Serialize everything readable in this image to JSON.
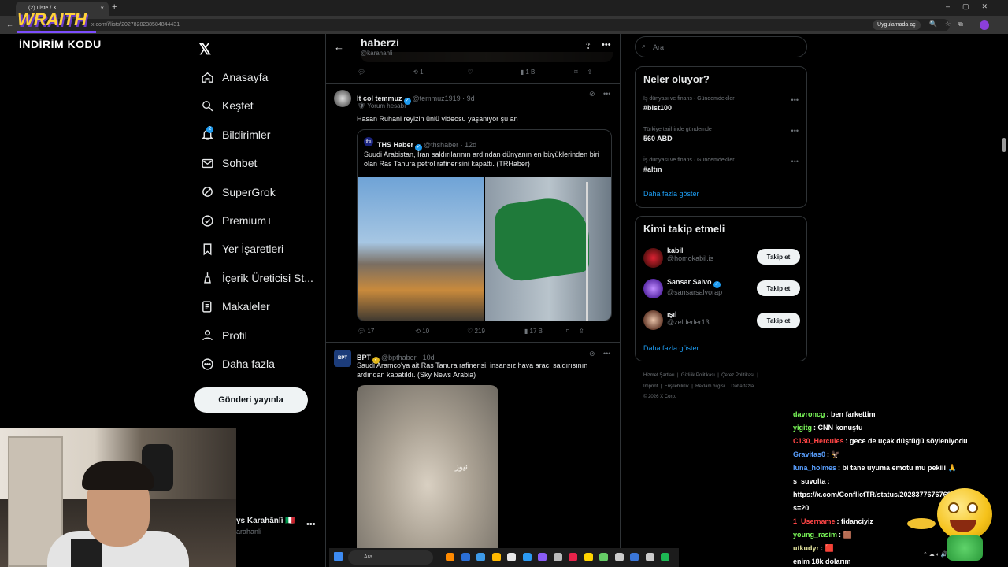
{
  "browser": {
    "tab_title": "(2) Liste / X",
    "url": "x.com/i/lists/2027828238584844431",
    "open_in_app": "Uygulamada aç"
  },
  "overlay": {
    "brand": "WRAITH",
    "promo": "İNDİRİM KODU"
  },
  "nav": {
    "items": [
      {
        "label": "Anasayfa",
        "icon": "home-icon"
      },
      {
        "label": "Keşfet",
        "icon": "search-icon"
      },
      {
        "label": "Bildirimler",
        "icon": "bell-icon"
      },
      {
        "label": "Sohbet",
        "icon": "mail-icon"
      },
      {
        "label": "SuperGrok",
        "icon": "grok-icon"
      },
      {
        "label": "Premium+",
        "icon": "premium-icon"
      },
      {
        "label": "Yer İşaretleri",
        "icon": "bookmark-icon"
      },
      {
        "label": "İçerik Üreticisi St...",
        "icon": "creator-icon"
      },
      {
        "label": "Makaleler",
        "icon": "articles-icon"
      },
      {
        "label": "Profil",
        "icon": "profile-icon"
      },
      {
        "label": "Daha fazla",
        "icon": "more-circle-icon"
      }
    ],
    "notif_count": "2",
    "post_button": "Gönderi yayınla",
    "account_name": "ys Karahânlî 🇮🇹",
    "account_handle": "arahanli"
  },
  "header": {
    "title": "haberzi",
    "subtitle": "@karahanli"
  },
  "top_actions": {
    "retweets": "1",
    "views": "1 B"
  },
  "tweet1": {
    "name": "It col temmuz",
    "handle": "@temmuz1919 · 9d",
    "badge": "Yorum hesabı",
    "text": "Hasan Ruhani reyizin ünlü videosu yaşanıyor şu an",
    "quote": {
      "logo": "ths",
      "name": "THS Haber",
      "handle": "@thshaber · 12d",
      "text": "Suudi Arabistan, İran saldırılarının ardından dünyanın en büyüklerinden biri olan Ras Tanura petrol rafinerisini kapattı. (TRHaber)"
    },
    "replies": "17",
    "retweets": "10",
    "likes": "219",
    "views": "17 B"
  },
  "tweet2": {
    "logo": "BPT",
    "name": "BPT",
    "handle": "@bpthaber · 10d",
    "text": "Saudi Aramco'ya ait Ras Tanura rafinerisi, insansız hava aracı saldırısının ardından kapatıldı. (Sky News Arabia)",
    "watermark": "نيوز"
  },
  "right": {
    "search_placeholder": "Ara",
    "trends_title": "Neler oluyor?",
    "trends": [
      {
        "meta": "İş dünyası ve finans · Gündemdekiler",
        "tag": "#bist100"
      },
      {
        "meta": "Türkiye tarihinde gündemde",
        "tag": "560 ABD"
      },
      {
        "meta": "İş dünyası ve finans · Gündemdekiler",
        "tag": "#altın"
      }
    ],
    "show_more": "Daha fazla göster",
    "follow_title": "Kimi takip etmeli",
    "follow": [
      {
        "name": "kabil",
        "handle": "@homokabil.is",
        "verified": false
      },
      {
        "name": "Sansar Salvo",
        "handle": "@sansarsalvorap",
        "verified": true
      },
      {
        "name": "ışıl",
        "handle": "@zelderler13",
        "verified": false
      }
    ],
    "follow_button": "Takip et",
    "footer_row1": [
      "Hizmet Şartları",
      "Gizlilik Politikası",
      "Çerez Politikası"
    ],
    "footer_row2": [
      "Imprint",
      "Erişilebilirlik",
      "Reklam bilgisi",
      "Daha fazla ..."
    ],
    "copyright": "© 2026 X Corp."
  },
  "chat": [
    {
      "user": "davroncg",
      "msg": ": ben farkettim",
      "color": "#7cfc5a"
    },
    {
      "user": "yigitg",
      "msg": ": CNN konuştu",
      "color": "#7cfc5a"
    },
    {
      "user": "C130_Hercules",
      "msg": ": gece de uçak düştüğü söyleniyodu",
      "color": "#ff4545"
    },
    {
      "user": "Gravitas0",
      "msg": ": 🦅",
      "color": "#5aa0ff"
    },
    {
      "user": "luna_holmes",
      "msg": ": bi tane uyuma emotu mu pekiii 🙏",
      "color": "#5aa0ff"
    },
    {
      "user": "s_suvolta",
      "msg": ":",
      "color": "#ffffff"
    },
    {
      "user": "",
      "msg": "https://x.com/ConflictTR/status/2028377676768051370?",
      "color": "#ffffff"
    },
    {
      "user": "",
      "msg": "s=20",
      "color": "#ffffff"
    },
    {
      "user": "1_Username",
      "msg": ": fidanciyiz",
      "color": "#ff4545"
    },
    {
      "user": "young_rasim",
      "msg": ": 🟫",
      "color": "#7cfc5a"
    },
    {
      "user": "utkudyr",
      "msg": ": 🟥",
      "color": "#e7e7a0"
    },
    {
      "user": "",
      "msg": "enim 18k dolarım",
      "color": "#ffffff"
    }
  ],
  "taskbar": {
    "search": "Ara"
  }
}
